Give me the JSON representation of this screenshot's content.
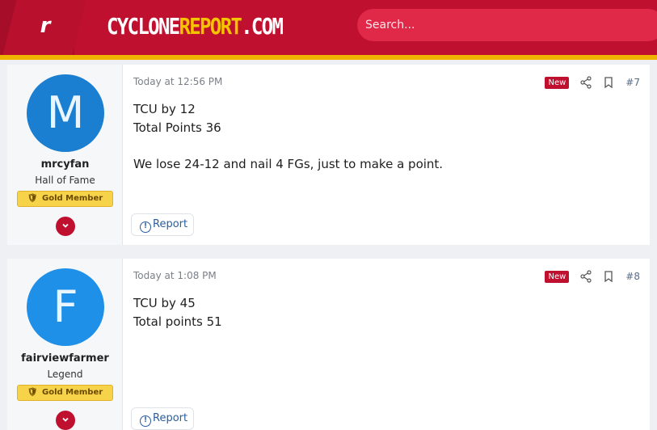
{
  "site": {
    "logo_letter": "r",
    "name_part1": "CYCLONE",
    "name_part2": "REPORT",
    "name_part3": ".COM"
  },
  "search": {
    "placeholder": "Search..."
  },
  "posts": [
    {
      "avatar_letter": "M",
      "username": "mrcyfan",
      "user_title": "Hall of Fame",
      "badge": "Gold Member",
      "timestamp": "Today at 12:56 PM",
      "new_label": "New",
      "post_number": "#7",
      "lines": [
        "TCU by 12",
        "Total Points 36",
        "",
        "We lose 24-12 and nail 4 FGs, just to make a point."
      ],
      "report_label": "Report"
    },
    {
      "avatar_letter": "F",
      "username": "fairviewfarmer",
      "user_title": "Legend",
      "badge": "Gold Member",
      "timestamp": "Today at 1:08 PM",
      "new_label": "New",
      "post_number": "#8",
      "lines": [
        "TCU by 45",
        "Total points 51"
      ],
      "report_label": "Report"
    }
  ],
  "icons": {
    "share": "share-icon",
    "bookmark": "bookmark-icon",
    "report": "report-icon",
    "expand": "chevron-down-icon",
    "badge": "shield-icon"
  },
  "colors": {
    "brand_red": "#c0102f",
    "brand_gold": "#f0b400",
    "avatar_blue": "#1b7fd1",
    "link_blue": "#2a5d9f"
  }
}
